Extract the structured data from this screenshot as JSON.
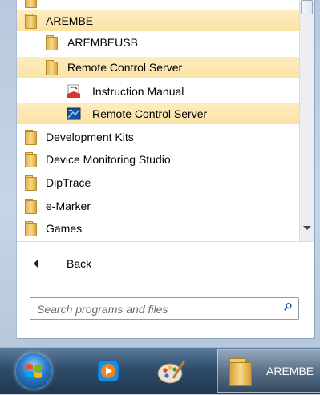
{
  "program_list": {
    "items": [
      {
        "label": "AREMBE",
        "icon": "folder-icon",
        "selected": true
      },
      {
        "label": "AREMBEUSB",
        "icon": "folder-icon",
        "selected": false
      },
      {
        "label": "Remote Control Server",
        "icon": "folder-icon",
        "selected": true
      },
      {
        "label": "Instruction Manual",
        "icon": "manual-pdf-icon",
        "selected": false
      },
      {
        "label": "Remote Control Server",
        "icon": "remote-server-app-icon",
        "selected": true
      },
      {
        "label": "Development Kits",
        "icon": "folder-icon",
        "selected": false
      },
      {
        "label": "Device Monitoring Studio",
        "icon": "folder-icon",
        "selected": false
      },
      {
        "label": "DipTrace",
        "icon": "folder-icon",
        "selected": false
      },
      {
        "label": "e-Marker",
        "icon": "folder-icon",
        "selected": false
      },
      {
        "label": "Games",
        "icon": "folder-icon",
        "selected": false
      }
    ]
  },
  "back": {
    "label": "Back"
  },
  "search": {
    "placeholder": "Search programs and files"
  },
  "taskbar": {
    "active_window_label": "AREMBE"
  },
  "colors": {
    "highlight": "#fbe3a6",
    "taskbar": "#2f4c6b"
  }
}
